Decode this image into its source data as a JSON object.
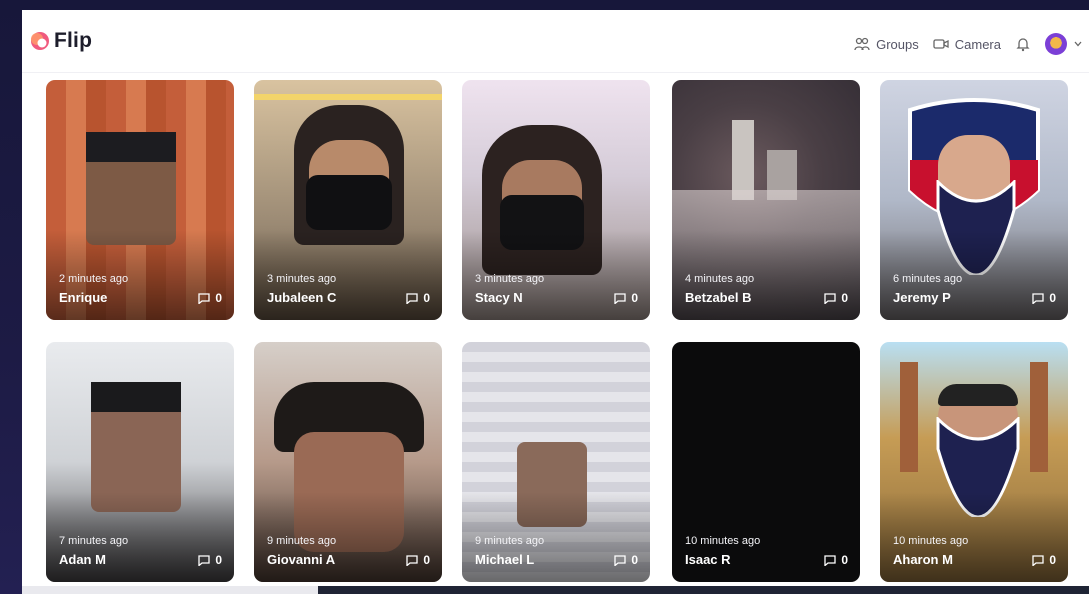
{
  "app": {
    "brand": "Flip",
    "nav": {
      "groups_label": "Groups",
      "camera_label": "Camera"
    }
  },
  "cards": [
    {
      "name": "Enrique",
      "time": "2 minutes ago",
      "comments": "0"
    },
    {
      "name": "Jubaleen C",
      "time": "3 minutes ago",
      "comments": "0"
    },
    {
      "name": "Stacy N",
      "time": "3 minutes ago",
      "comments": "0"
    },
    {
      "name": "Betzabel B",
      "time": "4 minutes ago",
      "comments": "0"
    },
    {
      "name": "Jeremy P",
      "time": "6 minutes ago",
      "comments": "0"
    },
    {
      "name": "Adan M",
      "time": "7 minutes ago",
      "comments": "0"
    },
    {
      "name": "Giovanni A",
      "time": "9 minutes ago",
      "comments": "0"
    },
    {
      "name": "Michael L",
      "time": "9 minutes ago",
      "comments": "0"
    },
    {
      "name": "Isaac R",
      "time": "10 minutes ago",
      "comments": "0"
    },
    {
      "name": "Aharon M",
      "time": "10 minutes ago",
      "comments": "0"
    }
  ],
  "icons": {
    "logo": "flip-logo",
    "groups": "groups-icon",
    "camera": "camera-icon",
    "bell": "bell-icon",
    "avatar": "avatar",
    "chevron": "chevron-down-icon",
    "comment": "comment-icon"
  },
  "colors": {
    "brand_accent": "#f05a7e",
    "nav_text": "#555566",
    "page_bg": "#ffffff"
  }
}
